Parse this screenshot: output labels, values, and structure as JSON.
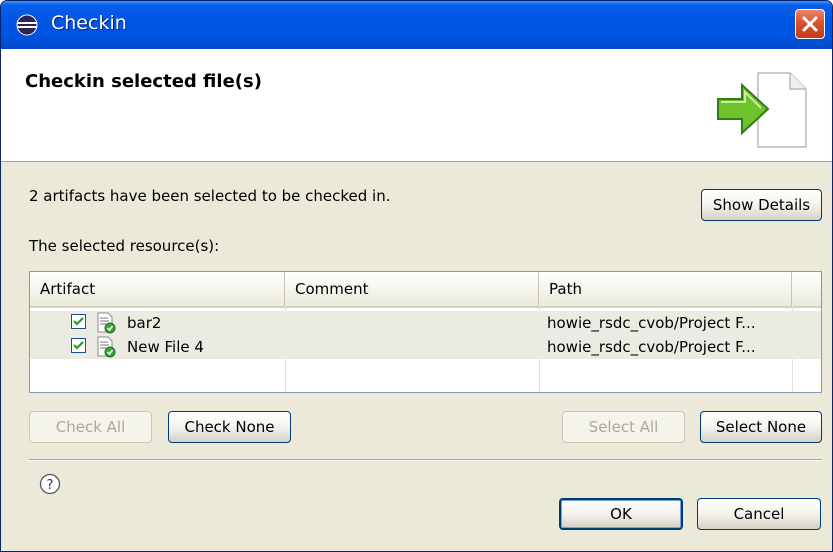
{
  "window": {
    "title": "Checkin",
    "close_icon": "close-icon"
  },
  "banner": {
    "title": "Checkin selected file(s)",
    "graphic": "checkin-arrow-icon"
  },
  "info_text": "2 artifacts have been selected to be checked in.",
  "show_details_label": "Show Details",
  "resources_label": "The selected resource(s):",
  "table": {
    "columns": [
      "Artifact",
      "Comment",
      "Path"
    ],
    "rows": [
      {
        "checked": true,
        "artifact": "bar2",
        "comment": "",
        "path": "howie_rsdc_cvob/Project F..."
      },
      {
        "checked": true,
        "artifact": "New File 4",
        "comment": "",
        "path": "howie_rsdc_cvob/Project F..."
      }
    ]
  },
  "buttons": {
    "check_all": "Check All",
    "check_none": "Check None",
    "select_all": "Select All",
    "select_none": "Select None",
    "ok": "OK",
    "cancel": "Cancel"
  },
  "colors": {
    "titlebar": "#0054e3",
    "dialog_bg": "#ece9d8",
    "close": "#d8532e",
    "checkbox_check": "#21a121"
  }
}
